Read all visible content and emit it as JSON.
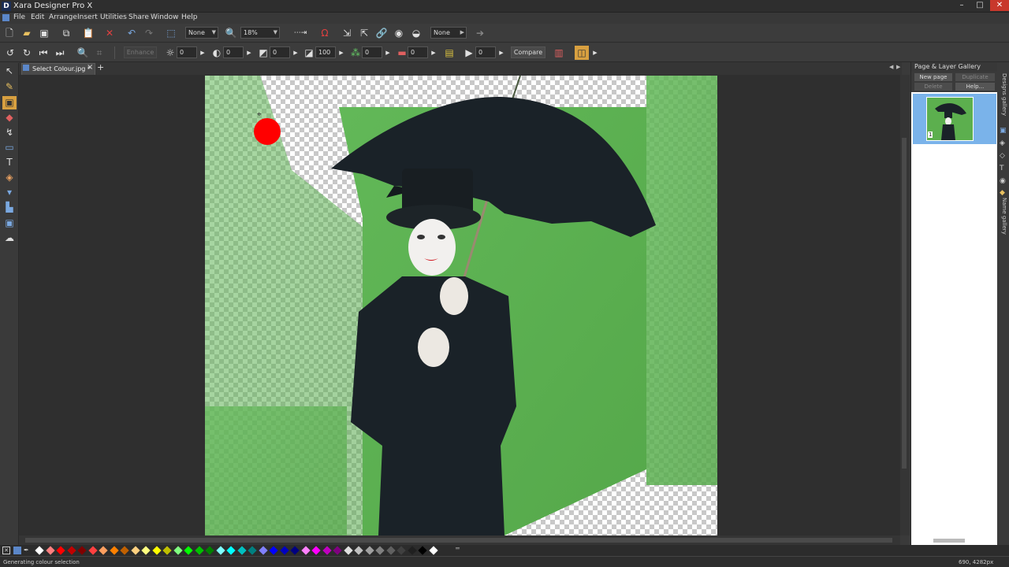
{
  "window": {
    "title": "Xara Designer Pro X",
    "app_icon": "D",
    "minimize": "–",
    "maximize": "□",
    "close": "✕"
  },
  "menu": [
    "File",
    "Edit",
    "Arrange",
    "Insert",
    "Utilities",
    "Share",
    "Window",
    "Help"
  ],
  "toolbar1": {
    "quality_value": "None",
    "zoom_value": "18%",
    "bevel_value": "None"
  },
  "toolbar2": {
    "enhance_label": "Enhance",
    "brightness": "0",
    "contrast": "0",
    "saturation": "0",
    "sharpness": "100",
    "temperature": "0",
    "tint": "0",
    "extra": "0",
    "compare_label": "Compare"
  },
  "document_tab": {
    "label": "Select Colour.jpg *",
    "close": "×",
    "add": "+"
  },
  "gallery": {
    "title": "Page & Layer Gallery",
    "new_page_label": "New page",
    "duplicate_label": "Duplicate",
    "delete_label": "Delete",
    "help_label": "Help...",
    "page_number": "1",
    "side_tabs": [
      "Designs gallery",
      "Name gallery"
    ]
  },
  "status": {
    "message": "Generating colour selection",
    "coords": "690, 4282px"
  },
  "colors": {
    "marker": "#ff0000",
    "green_screen": "#5caf4e",
    "thumb_selected_bg": "#7ab3ea"
  },
  "palette": [
    "#ffffff",
    "#ff7f7f",
    "#ff0000",
    "#c00000",
    "#800000",
    "#ff4040",
    "#ff9f60",
    "#ff8000",
    "#c06000",
    "#ffd080",
    "#ffff80",
    "#ffff00",
    "#c0c000",
    "#80ff80",
    "#00ff00",
    "#00c000",
    "#008000",
    "#80ffff",
    "#00ffff",
    "#00c0c0",
    "#008080",
    "#8080ff",
    "#0000ff",
    "#0000c0",
    "#000080",
    "#ff80ff",
    "#ff00ff",
    "#c000c0",
    "#800080",
    "#e0e0e0",
    "#c0c0c0",
    "#a0a0a0",
    "#808080",
    "#606060",
    "#404040",
    "#202020",
    "#000000",
    "#ffffff"
  ]
}
